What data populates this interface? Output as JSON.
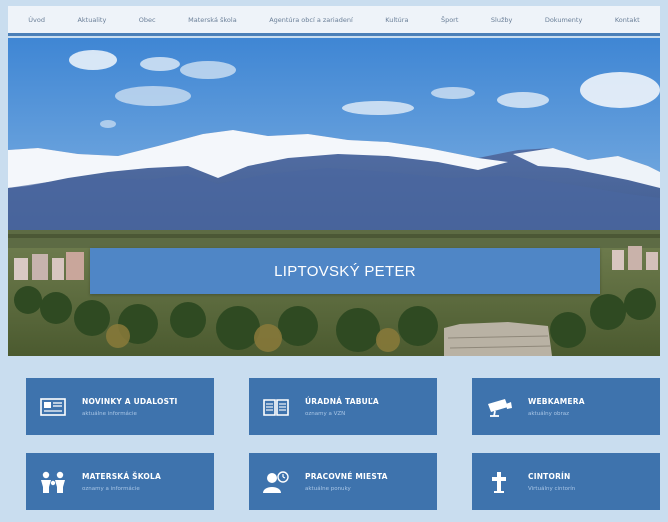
{
  "nav": {
    "items": [
      "Úvod",
      "Aktuality",
      "Obec",
      "Materská škola",
      "Agentúra obcí a zariadení",
      "Kultúra",
      "Šport",
      "Služby",
      "Dokumenty",
      "Kontakt"
    ]
  },
  "hero": {
    "title": "LIPTOVSKÝ PETER"
  },
  "tiles": [
    {
      "title": "NOVINKY A UDALOSTI",
      "subtitle": "aktuálne informácie",
      "icon": "newspaper-icon"
    },
    {
      "title": "ÚRADNÁ TABUĽA",
      "subtitle": "oznamy a VZN",
      "icon": "open-book-icon"
    },
    {
      "title": "WEBKAMERA",
      "subtitle": "aktuálny obraz",
      "icon": "camera-icon"
    },
    {
      "title": "MATERSKÁ ŠKOLA",
      "subtitle": "oznamy a informácie",
      "icon": "family-icon"
    },
    {
      "title": "PRACOVNÉ MIESTA",
      "subtitle": "aktuálne ponuky",
      "icon": "job-icon"
    },
    {
      "title": "CINTORÍN",
      "subtitle": "Virtuálny cintorín",
      "icon": "cross-icon"
    }
  ],
  "colors": {
    "tile": "#3e73ad",
    "banner": "#4f86c6",
    "background": "#c9ddef"
  }
}
